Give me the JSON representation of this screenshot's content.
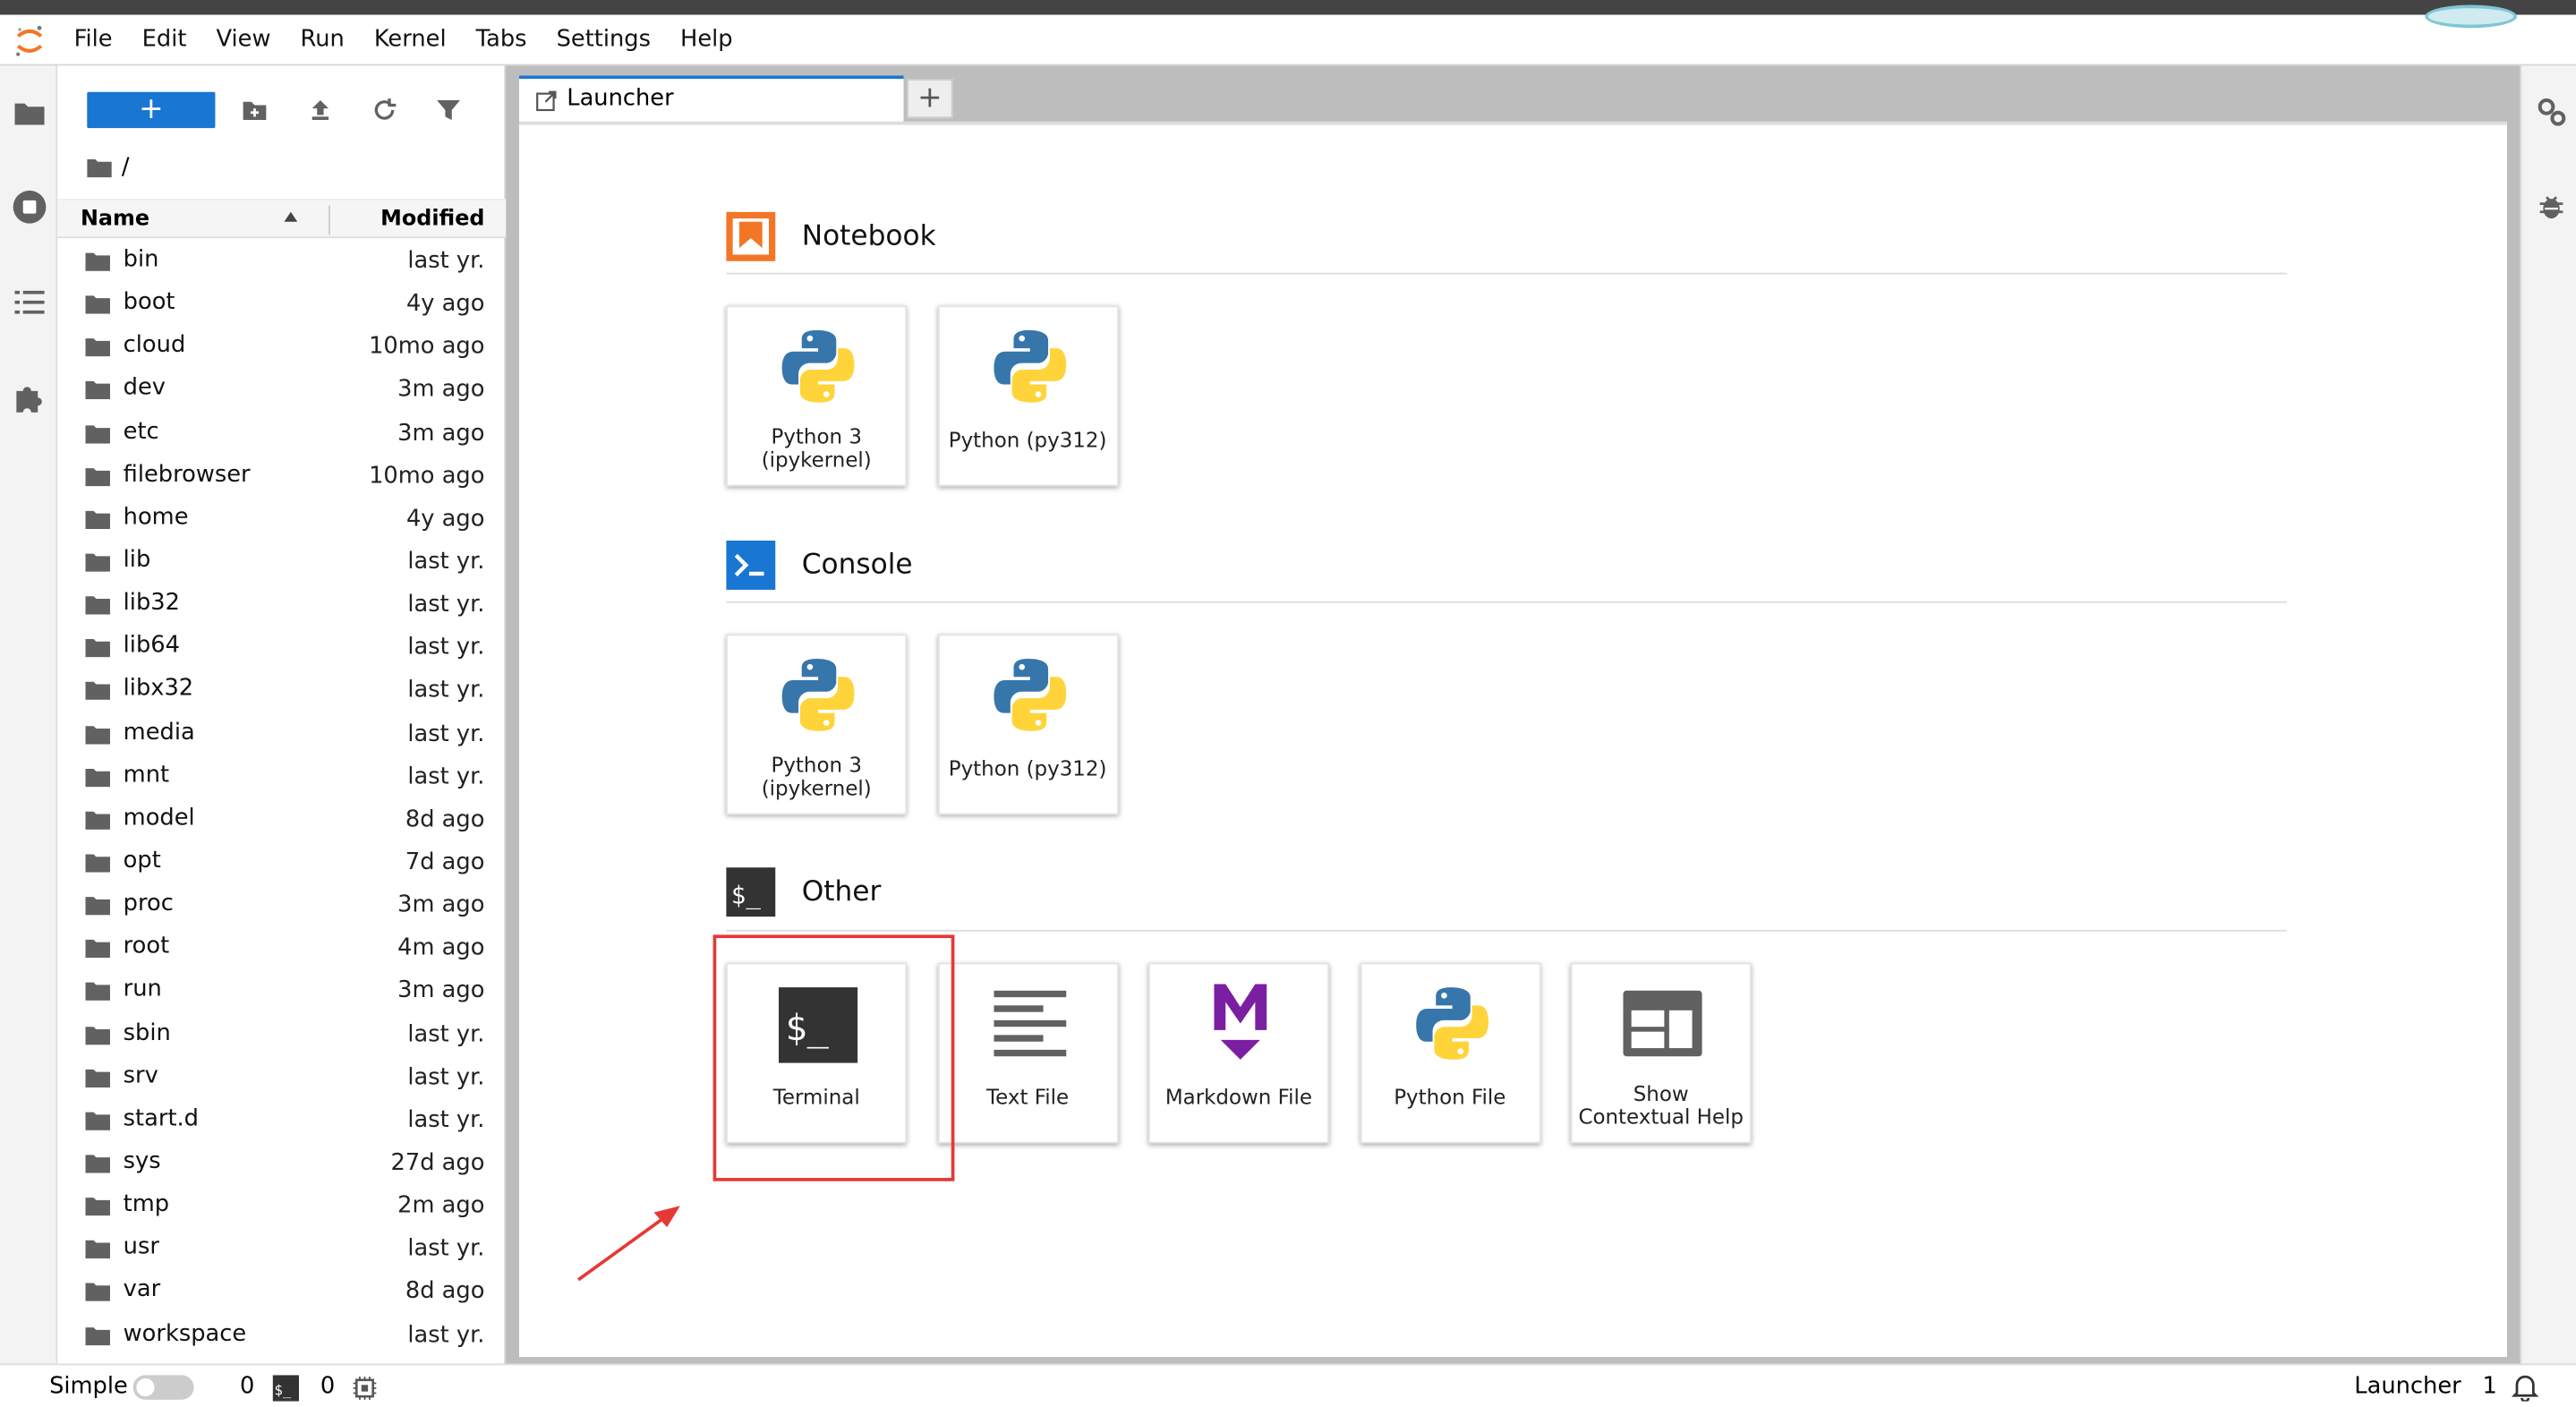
{
  "menubar": {
    "items": [
      "File",
      "Edit",
      "View",
      "Run",
      "Kernel",
      "Tabs",
      "Settings",
      "Help"
    ]
  },
  "file_browser": {
    "new_button_label": "+",
    "breadcrumb": "/",
    "columns": {
      "name": "Name",
      "modified": "Modified"
    },
    "files": [
      {
        "name": "bin",
        "modified": "last yr."
      },
      {
        "name": "boot",
        "modified": "4y ago"
      },
      {
        "name": "cloud",
        "modified": "10mo ago"
      },
      {
        "name": "dev",
        "modified": "3m ago"
      },
      {
        "name": "etc",
        "modified": "3m ago"
      },
      {
        "name": "filebrowser",
        "modified": "10mo ago"
      },
      {
        "name": "home",
        "modified": "4y ago"
      },
      {
        "name": "lib",
        "modified": "last yr."
      },
      {
        "name": "lib32",
        "modified": "last yr."
      },
      {
        "name": "lib64",
        "modified": "last yr."
      },
      {
        "name": "libx32",
        "modified": "last yr."
      },
      {
        "name": "media",
        "modified": "last yr."
      },
      {
        "name": "mnt",
        "modified": "last yr."
      },
      {
        "name": "model",
        "modified": "8d ago"
      },
      {
        "name": "opt",
        "modified": "7d ago"
      },
      {
        "name": "proc",
        "modified": "3m ago"
      },
      {
        "name": "root",
        "modified": "4m ago"
      },
      {
        "name": "run",
        "modified": "3m ago"
      },
      {
        "name": "sbin",
        "modified": "last yr."
      },
      {
        "name": "srv",
        "modified": "last yr."
      },
      {
        "name": "start.d",
        "modified": "last yr."
      },
      {
        "name": "sys",
        "modified": "27d ago"
      },
      {
        "name": "tmp",
        "modified": "2m ago"
      },
      {
        "name": "usr",
        "modified": "last yr."
      },
      {
        "name": "var",
        "modified": "8d ago"
      },
      {
        "name": "workspace",
        "modified": "last yr."
      }
    ]
  },
  "tabs": {
    "active_label": "Launcher",
    "add_label": "+"
  },
  "launcher": {
    "notebook": {
      "title": "Notebook",
      "cards": [
        {
          "label": "Python 3\n(ipykernel)",
          "icon": "python-logo-icon"
        },
        {
          "label": "Python (py312)",
          "icon": "python-logo-icon"
        }
      ]
    },
    "console": {
      "title": "Console",
      "cards": [
        {
          "label": "Python 3\n(ipykernel)",
          "icon": "python-logo-icon"
        },
        {
          "label": "Python (py312)",
          "icon": "python-logo-icon"
        }
      ]
    },
    "other": {
      "title": "Other",
      "cards": [
        {
          "label": "Terminal",
          "icon": "terminal-icon"
        },
        {
          "label": "Text File",
          "icon": "text-file-icon"
        },
        {
          "label": "Markdown File",
          "icon": "markdown-icon"
        },
        {
          "label": "Python File",
          "icon": "python-logo-icon"
        },
        {
          "label": "Show\nContextual Help",
          "icon": "contextual-help-icon"
        }
      ]
    },
    "terminal_glyph": "$_"
  },
  "statusbar": {
    "mode_label": "Simple",
    "kernels_count": "0",
    "terminals_count": "0",
    "terminal_glyph": "$_",
    "active_document": "Launcher",
    "notifications_count": "1"
  },
  "colors": {
    "accent": "#1976d2",
    "highlight": "#e53935",
    "notebook_orange": "#f37626",
    "markdown_purple": "#7b1fa2"
  }
}
